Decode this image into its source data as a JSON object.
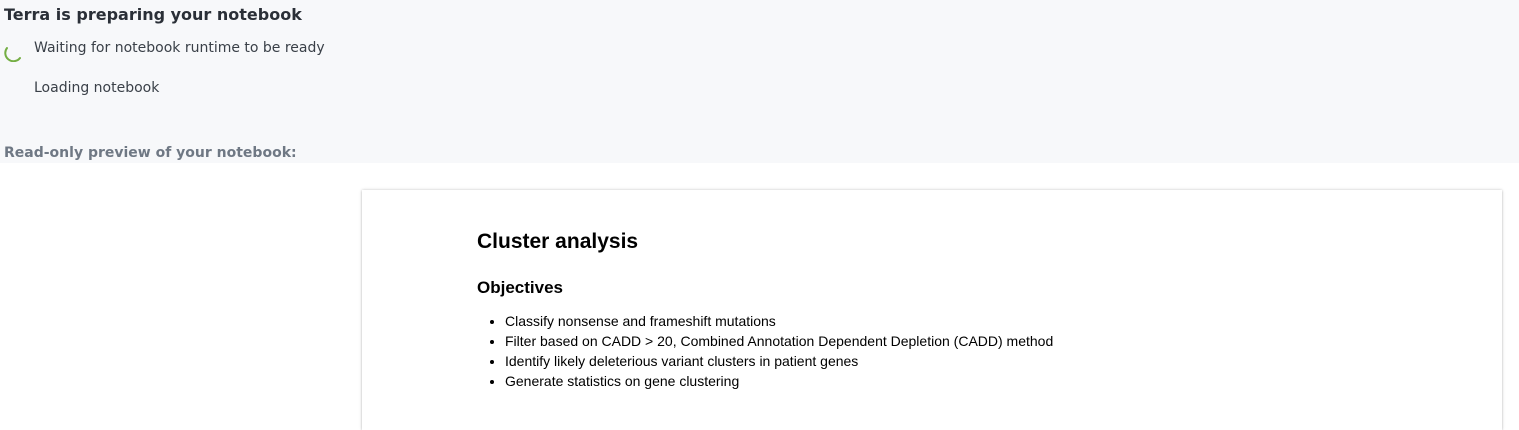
{
  "status": {
    "title": "Terra is preparing your notebook",
    "steps": [
      {
        "label": "Waiting for notebook runtime to be ready",
        "state": "in-progress",
        "icon": "loading-spinner-icon"
      },
      {
        "label": "Loading notebook",
        "state": "pending"
      }
    ],
    "spinner_color": "#74ae43"
  },
  "preview": {
    "label": "Read-only preview of your notebook:"
  },
  "notebook": {
    "title": "Cluster analysis",
    "section_heading": "Objectives",
    "objectives": [
      "Classify nonsense and frameshift mutations",
      "Filter based on CADD > 20, Combined Annotation Dependent Depletion (CADD) method",
      "Identify likely deleterious variant clusters in patient genes",
      "Generate statistics on gene clustering"
    ]
  }
}
